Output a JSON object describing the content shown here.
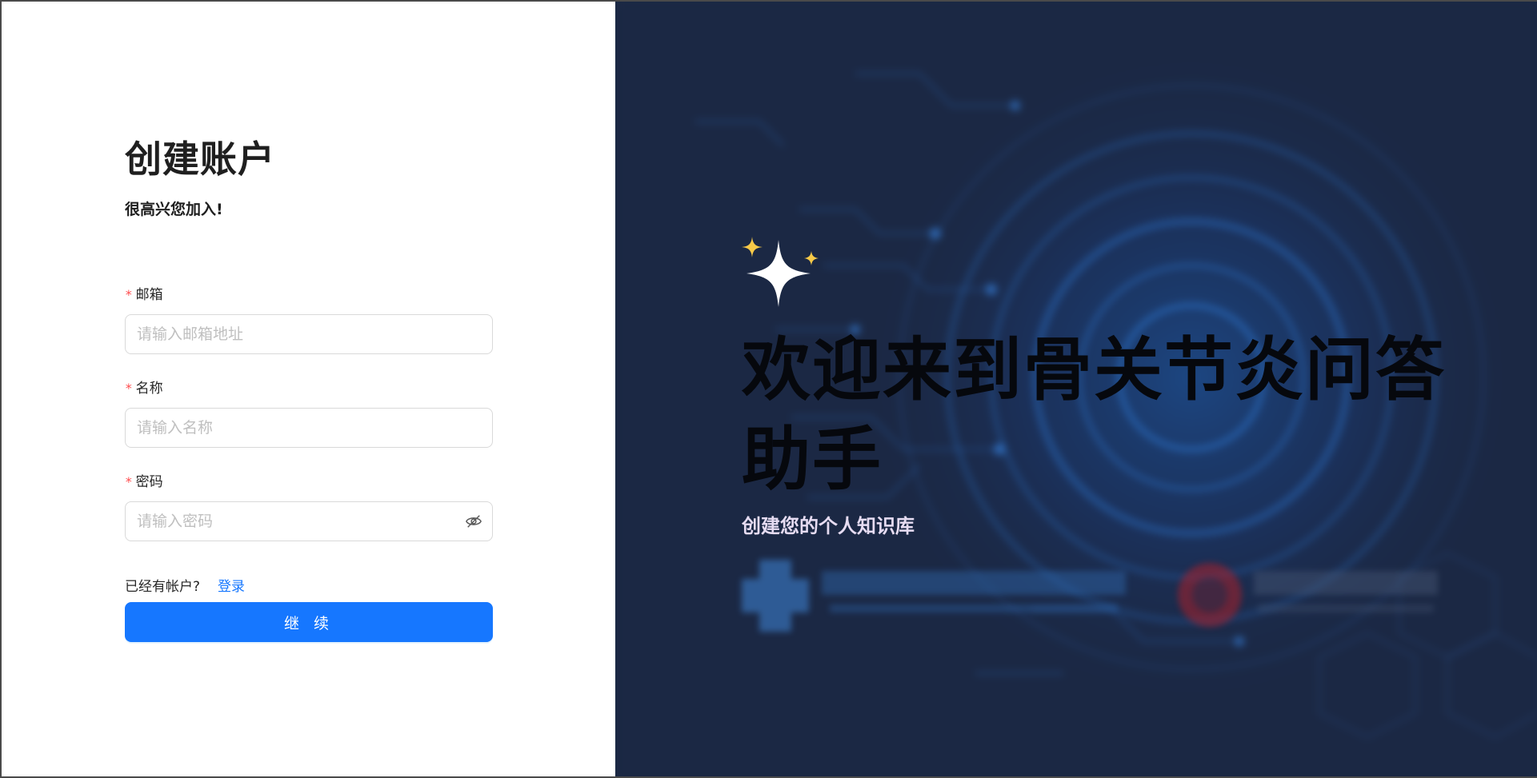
{
  "form": {
    "title": "创建账户",
    "subtitle": "很高兴您加入!",
    "required_mark": "*",
    "email": {
      "label": "邮箱",
      "value": "",
      "placeholder": "请输入邮箱地址"
    },
    "name": {
      "label": "名称",
      "value": "",
      "placeholder": "请输入名称"
    },
    "password": {
      "label": "密码",
      "value": "",
      "placeholder": "请输入密码",
      "toggle_icon": "eye-invisible-icon"
    },
    "have_account_text": "已经有帐户?",
    "login_link": "登录",
    "continue_button": "继 续"
  },
  "hero": {
    "icon": "sparkle-icon",
    "title": "欢迎来到骨关节炎问答助手",
    "subtitle": "创建您的个人知识库"
  },
  "colors": {
    "primary": "#1677ff",
    "required": "#ff4d4f",
    "hero_bg": "#1b2844",
    "sparkle_gold": "#f7c948",
    "hero_subtitle": "#e6dcf2"
  }
}
